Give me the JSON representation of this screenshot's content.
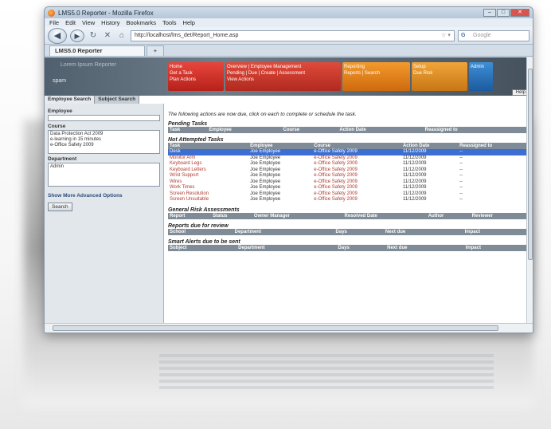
{
  "browser": {
    "window_title": "LMS5.0 Reporter - Mozilla Firefox",
    "menu": [
      "File",
      "Edit",
      "View",
      "History",
      "Bookmarks",
      "Tools",
      "Help"
    ],
    "url": "http://localhost/lms_det/Report_Home.asp",
    "search_placeholder": "Google",
    "tab_title": "LMS5.0 Reporter",
    "new_tab": "+"
  },
  "header": {
    "brand": "Lorem Ipsum Reporter",
    "user": "spam",
    "tiles": [
      {
        "label": "Home",
        "color": "#c8281e"
      },
      {
        "label": "Overview | Employee Management",
        "color": "#c42a1f"
      },
      {
        "label": "Reporting",
        "color": "#e07a16"
      },
      {
        "label": "Setup",
        "color": "#e0891e"
      },
      {
        "label": "Admin",
        "color": "#2567b0"
      }
    ],
    "subtiles": [
      "Get a Task",
      "Plan Actions",
      "Pending | Due | Create | Assessment",
      "Reports | Search",
      "Due Risk",
      "View Actions"
    ],
    "help": "Help"
  },
  "sidebar": {
    "tabs": [
      "Employee Search",
      "Subject Search"
    ],
    "employee_label": "Employee",
    "course_label": "Course",
    "courses": [
      "Data Protection Act 2009",
      "e-learning in 15 minutes",
      "e-Office Safety 2009"
    ],
    "department_label": "Department",
    "departments": [
      "Admin"
    ],
    "advanced_link": "Show More Advanced Options",
    "search_button": "Search"
  },
  "main": {
    "intro": "The following actions are now due, click on each to complete or schedule the task.",
    "pending": {
      "title": "Pending Tasks",
      "columns": [
        "Task",
        "Employee",
        "Course",
        "Action Date",
        "Reassigned to"
      ],
      "rows": []
    },
    "not_attempted": {
      "title": "Not Attempted Tasks",
      "columns": [
        "Task",
        "Employee",
        "Course",
        "Action Date",
        "Reassigned to"
      ],
      "rows": [
        {
          "task": "Desk",
          "employee": "Joe Employee",
          "course": "e-Office Safety 2009",
          "date": "11/12/2009",
          "reassigned": "--",
          "selected": true
        },
        {
          "task": "Monitor Arm",
          "employee": "Joe Employee",
          "course": "e-Office Safety 2009",
          "date": "11/12/2009",
          "reassigned": "--",
          "selected": false
        },
        {
          "task": "Keyboard Legs",
          "employee": "Joe Employee",
          "course": "e-Office Safety 2009",
          "date": "11/12/2009",
          "reassigned": "--",
          "selected": false
        },
        {
          "task": "Keyboard Letters",
          "employee": "Joe Employee",
          "course": "e-Office Safety 2009",
          "date": "11/12/2009",
          "reassigned": "--",
          "selected": false
        },
        {
          "task": "Wrist Support",
          "employee": "Joe Employee",
          "course": "e-Office Safety 2009",
          "date": "11/12/2009",
          "reassigned": "--",
          "selected": false
        },
        {
          "task": "Wires",
          "employee": "Joe Employee",
          "course": "e-Office Safety 2009",
          "date": "11/12/2009",
          "reassigned": "--",
          "selected": false
        },
        {
          "task": "Work Times",
          "employee": "Joe Employee",
          "course": "e-Office Safety 2009",
          "date": "11/12/2009",
          "reassigned": "--",
          "selected": false
        },
        {
          "task": "Screen Resolution",
          "employee": "Joe Employee",
          "course": "e-Office Safety 2009",
          "date": "11/12/2009",
          "reassigned": "--",
          "selected": false
        },
        {
          "task": "Screen Unsuitable",
          "employee": "Joe Employee",
          "course": "e-Office Safety 2009",
          "date": "11/12/2009",
          "reassigned": "--",
          "selected": false
        }
      ]
    },
    "risk": {
      "title": "General Risk Assessments",
      "columns": [
        "Report",
        "Status",
        "Owner Manager",
        "Resolved Date",
        "Author",
        "Reviewer"
      ]
    },
    "reports_review": {
      "title": "Reports due for review",
      "columns": [
        "School",
        "Department",
        "Days",
        "Next due",
        "Impact"
      ]
    },
    "smart_alerts": {
      "title": "Smart Alerts due to be sent",
      "columns": [
        "Subject",
        "Department",
        "Days",
        "Next due",
        "Impact"
      ]
    }
  }
}
